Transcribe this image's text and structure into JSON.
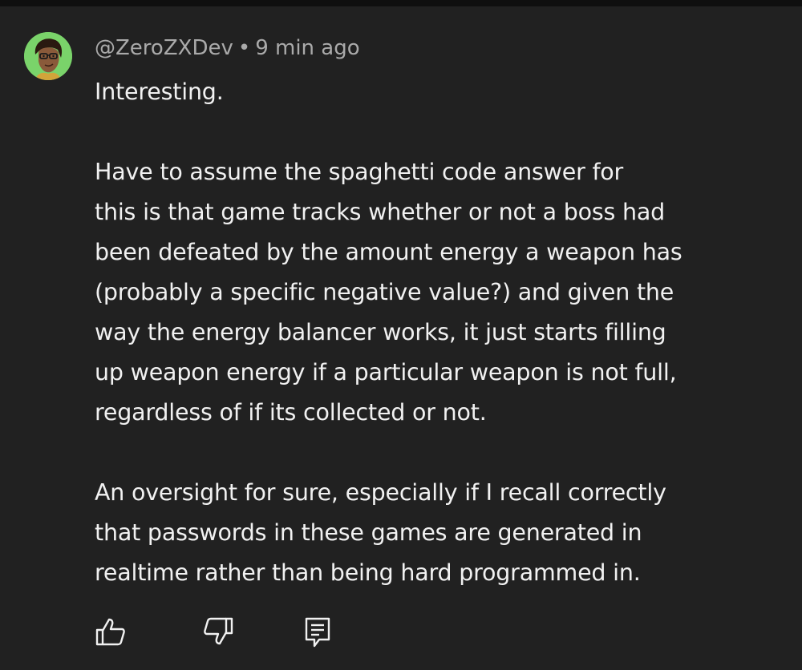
{
  "comment": {
    "author": "@ZeroZXDev",
    "separator": "•",
    "time": "9 min ago",
    "paragraphs": [
      "Interesting.",
      "Have to assume the spaghetti code answer for\nthis is that game tracks whether or not a boss had\nbeen defeated by the amount energy a weapon has\n(probably a specific negative value?) and given the\nway the energy balancer works, it just starts filling\nup weapon energy if a particular weapon is not full,\nregardless of if its collected or not.",
      "An oversight for sure, especially if I recall correctly\nthat passwords in these games are generated in\nrealtime rather than being hard programmed in."
    ]
  },
  "actions": {
    "like_icon": "thumbs-up-icon",
    "dislike_icon": "thumbs-down-icon",
    "reply_icon": "reply-comment-icon"
  },
  "colors": {
    "background": "#212121",
    "text": "#f1f1f1",
    "secondary_text": "#aaaaaa",
    "avatar_ring": "#7ad36a"
  }
}
